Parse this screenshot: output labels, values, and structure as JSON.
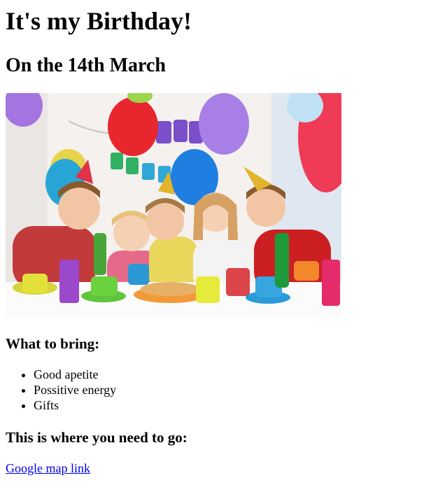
{
  "heading": "It's my Birthday!",
  "subheading": "On the 14th March",
  "bring": {
    "title": "What to bring:",
    "items": [
      "Good apetite",
      "Possitive energy",
      "Gifts"
    ]
  },
  "directions": {
    "title": "This is where you need to go:",
    "link_label": "Google map link"
  },
  "colors": {
    "link": "#0000ee",
    "text": "#000000",
    "background": "#ffffff"
  }
}
